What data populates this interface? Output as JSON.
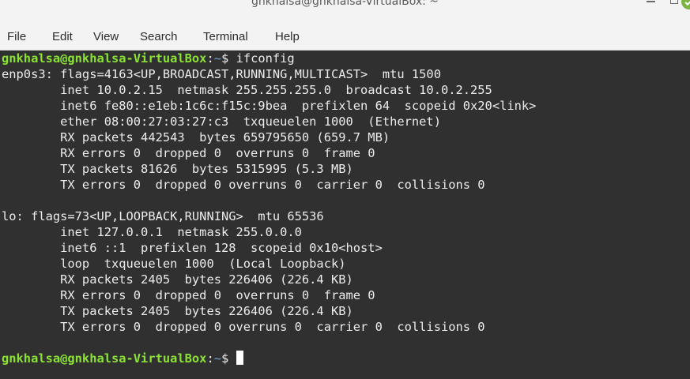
{
  "window": {
    "title": "gnkhalsa@gnkhalsa-VirtualBox: ~"
  },
  "menu": {
    "items": [
      "File",
      "Edit",
      "View",
      "Search",
      "Terminal",
      "Help"
    ]
  },
  "prompt": {
    "user_host": "gnkhalsa@gnkhalsa-VirtualBox",
    "colon": ":",
    "path": "~",
    "symbol": "$ "
  },
  "command": "ifconfig",
  "output": [
    "enp0s3: flags=4163<UP,BROADCAST,RUNNING,MULTICAST>  mtu 1500",
    "        inet 10.0.2.15  netmask 255.255.255.0  broadcast 10.0.2.255",
    "        inet6 fe80::e1eb:1c6c:f15c:9bea  prefixlen 64  scopeid 0x20<link>",
    "        ether 08:00:27:03:27:c3  txqueuelen 1000  (Ethernet)",
    "        RX packets 442543  bytes 659795650 (659.7 MB)",
    "        RX errors 0  dropped 0  overruns 0  frame 0",
    "        TX packets 81626  bytes 5315995 (5.3 MB)",
    "        TX errors 0  dropped 0 overruns 0  carrier 0  collisions 0",
    "",
    "lo: flags=73<UP,LOOPBACK,RUNNING>  mtu 65536",
    "        inet 127.0.0.1  netmask 255.0.0.0",
    "        inet6 ::1  prefixlen 128  scopeid 0x10<host>",
    "        loop  txqueuelen 1000  (Local Loopback)",
    "        RX packets 2405  bytes 226406 (226.4 KB)",
    "        RX errors 0  dropped 0  overruns 0  frame 0",
    "        TX packets 2405  bytes 226406 (226.4 KB)",
    "        TX errors 0  dropped 0 overruns 0  carrier 0  collisions 0",
    ""
  ],
  "colors": {
    "terminal_bg": "#303030",
    "terminal_fg": "#ececec",
    "prompt_user": "#8ae234",
    "prompt_path": "#729fcf",
    "chrome_bg": "#f3f3f3"
  },
  "icons": {
    "minimize": "minimize-icon",
    "maximize": "maximize-icon",
    "close": "close-icon"
  }
}
